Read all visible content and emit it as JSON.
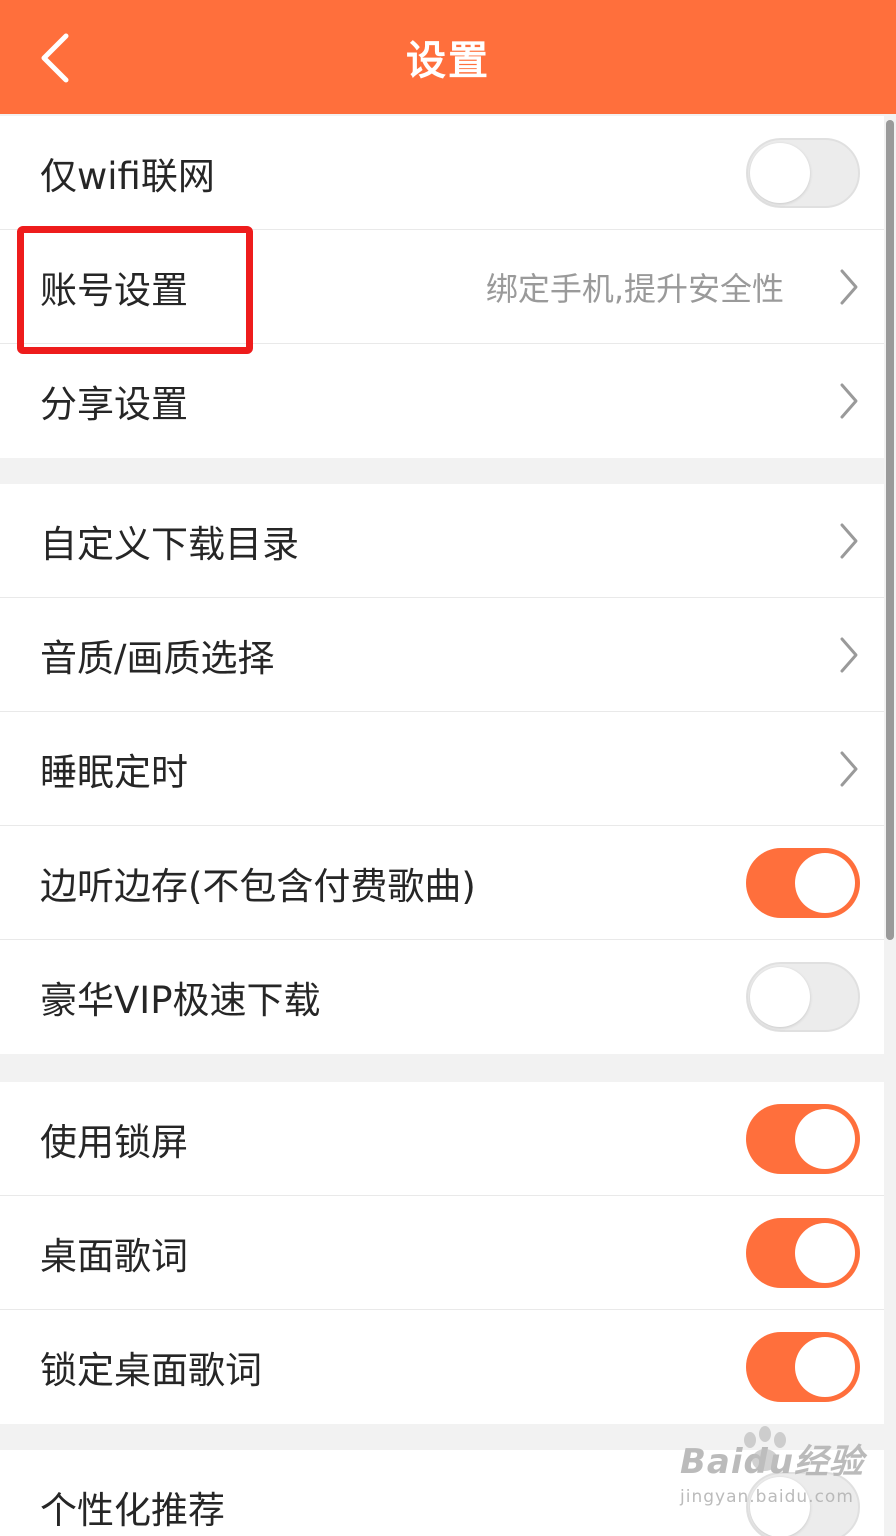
{
  "header": {
    "title": "设置"
  },
  "sections": [
    {
      "rows": [
        {
          "label": "仅wifi联网",
          "control": "toggle",
          "on": false
        },
        {
          "label": "账号设置",
          "sub": "绑定手机,提升安全性",
          "control": "chevron"
        },
        {
          "label": "分享设置",
          "control": "chevron"
        }
      ]
    },
    {
      "rows": [
        {
          "label": "自定义下载目录",
          "control": "chevron"
        },
        {
          "label": "音质/画质选择",
          "control": "chevron"
        },
        {
          "label": "睡眠定时",
          "control": "chevron"
        },
        {
          "label": "边听边存(不包含付费歌曲)",
          "control": "toggle",
          "on": true
        },
        {
          "label": "豪华VIP极速下载",
          "control": "toggle",
          "on": false
        }
      ]
    },
    {
      "rows": [
        {
          "label": "使用锁屏",
          "control": "toggle",
          "on": true
        },
        {
          "label": "桌面歌词",
          "control": "toggle",
          "on": true
        },
        {
          "label": "锁定桌面歌词",
          "control": "toggle",
          "on": true
        }
      ]
    },
    {
      "rows": [
        {
          "label": "个性化推荐",
          "control": "toggle",
          "on": false
        }
      ]
    }
  ],
  "watermark": {
    "brand": "Baidu经验",
    "url": "jingyan.baidu.com"
  },
  "colors": {
    "accent": "#ff6f3c",
    "highlight": "#ee1c1c"
  }
}
